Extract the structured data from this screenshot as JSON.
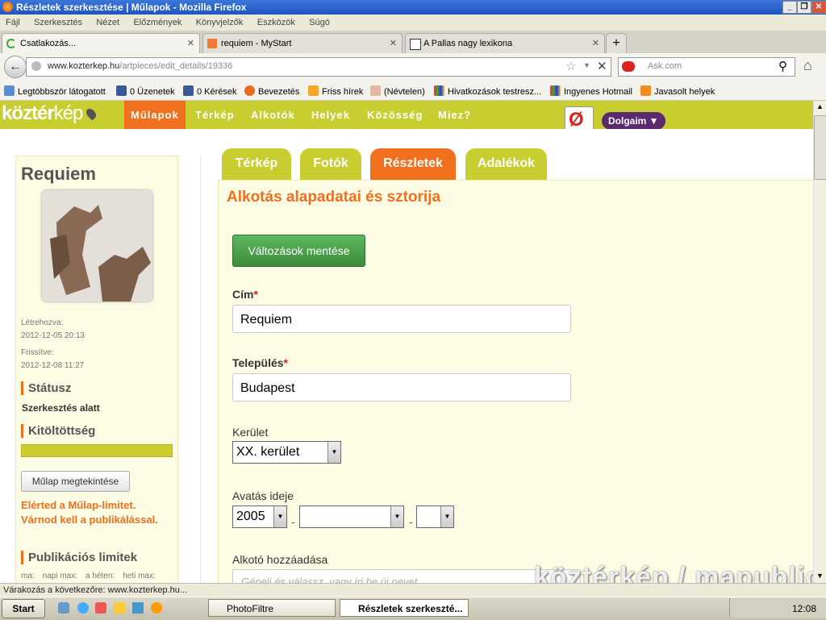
{
  "window": {
    "title": "Részletek szerkesztése | Műlapok - Mozilla Firefox"
  },
  "menu": [
    "Fájl",
    "Szerkesztés",
    "Nézet",
    "Előzmények",
    "Könyvjelzők",
    "Eszközök",
    "Súgó"
  ],
  "tabs": [
    {
      "label": "Csatlakozás..."
    },
    {
      "label": "requiem - MyStart"
    },
    {
      "label": "A Pallas nagy lexikona"
    }
  ],
  "address": {
    "domain": "www.kozterkep.hu",
    "path": "/artpieces/edit_details/19336"
  },
  "search": {
    "placeholder": "Ask.com"
  },
  "bookmarks": [
    "Legtöbbször látogatott",
    "0 Üzenetek",
    "0 Kérések",
    "Bevezetés",
    "Friss hírek",
    "(Névtelen)",
    "Hivatkozások testresz...",
    "Ingyenes Hotmail",
    "Javasolt helyek"
  ],
  "site": {
    "logo_a": "köztér",
    "logo_b": "kép",
    "nav": [
      "Műlapok",
      "Térkép",
      "Alkotók",
      "Helyek",
      "Közösség",
      "Miez?"
    ],
    "user_menu": "Dolgaim ▼"
  },
  "sidebar": {
    "title": "Requiem",
    "created_label": "Létrehozva:",
    "created": "2012-12-05 20:13",
    "updated_label": "Frissítve:",
    "updated": "2012-12-08 11:27",
    "status_head": "Státusz",
    "status": "Szerkesztés alatt",
    "completion_head": "Kitöltöttség",
    "completion": 1.0,
    "view_button": "Műlap megtekintése",
    "limit_msg": "Elérted a Műlap-limitet. Várnod kell a publikálással.",
    "pub_head": "Publikációs limitek",
    "pub_cols": [
      "ma:",
      "napi max:",
      "a héten:",
      "heti max:"
    ]
  },
  "content_tabs": [
    "Térkép",
    "Fotók",
    "Részletek",
    "Adalékok"
  ],
  "form": {
    "heading": "Alkotás alapadatai és sztorija",
    "save_button": "Változások mentése",
    "title_label": "Cím",
    "title_value": "Requiem",
    "town_label": "Település",
    "town_value": "Budapest",
    "required_mark": "*",
    "district_label": "Kerület",
    "district_value": "XX. kerület",
    "inaug_label": "Avatás ideje",
    "inaug_year": "2005",
    "inaug_month": "",
    "inaug_day": "",
    "date_sep": "-",
    "creator_label": "Alkotó hozzáadása",
    "creator_placeholder": "Gépeli és válassz, vagy írj be új nevet"
  },
  "watermark": "köztérkép / mapublic",
  "status_bar": "Várakozás a következőre: www.kozterkep.hu...",
  "taskbar": {
    "start": "Start",
    "tasks": [
      "PhotoFiltre",
      "Részletek szerkeszté..."
    ],
    "clock": "12:08"
  }
}
